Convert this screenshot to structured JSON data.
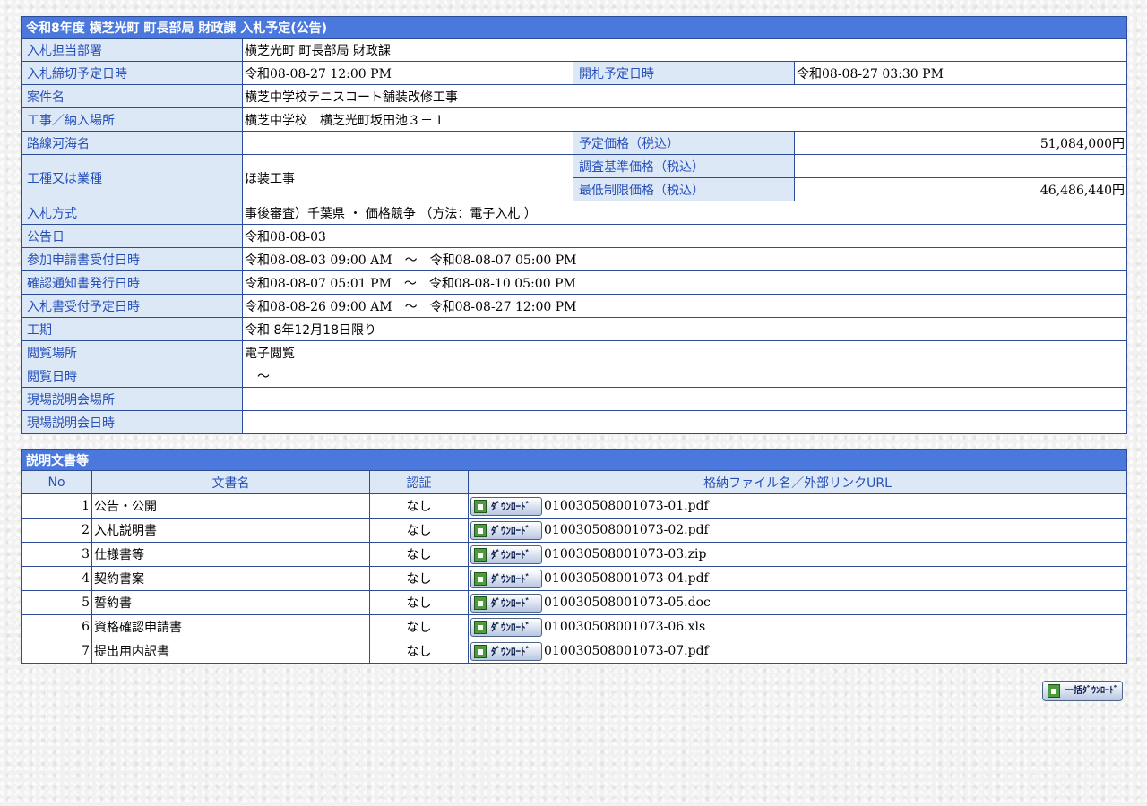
{
  "info": {
    "title": "令和8年度  横芝光町  町長部局  財政課  入札予定(公告)",
    "dept": {
      "label": "入札担当部署",
      "value": "横芝光町  町長部局  財政課"
    },
    "deadline": {
      "label": "入札締切予定日時",
      "value": "令和08-08-27 12:00 PM"
    },
    "opening": {
      "label": "開札予定日時",
      "value": "令和08-08-27 03:30 PM"
    },
    "project": {
      "label": "案件名",
      "value": "横芝中学校テニスコート舗装改修工事"
    },
    "location": {
      "label": "工事／納入場所",
      "value": "横芝中学校　横芝光町坂田池３－１"
    },
    "route": {
      "label": "路線河海名",
      "value": ""
    },
    "est_price": {
      "label": "予定価格（税込）",
      "value": "51,084,000円"
    },
    "work_type": {
      "label": "工種又は業種",
      "value": "ほ装工事"
    },
    "survey_price": {
      "label": "調査基準価格（税込）",
      "value": "-"
    },
    "min_price": {
      "label": "最低制限価格（税込）",
      "value": "46,486,440円"
    },
    "method": {
      "label": "入札方式",
      "value": "事後審査）千葉県 ・ 価格競争 （方法：電子入札 ）"
    },
    "notice_date": {
      "label": "公告日",
      "value": "令和08-08-03"
    },
    "apply": {
      "label": "参加申請書受付日時",
      "value": "令和08-08-03 09:00 AM　～　令和08-08-07 05:00 PM"
    },
    "confirm": {
      "label": "確認通知書発行日時",
      "value": "令和08-08-07 05:01 PM　～　令和08-08-10 05:00 PM"
    },
    "bid_accept": {
      "label": "入札書受付予定日時",
      "value": "令和08-08-26 09:00 AM　～　令和08-08-27 12:00 PM"
    },
    "period": {
      "label": "工期",
      "value": "令和 8年12月18日限り"
    },
    "view_place": {
      "label": "閲覧場所",
      "value": "電子閲覧"
    },
    "view_time": {
      "label": "閲覧日時",
      "value": "　～"
    },
    "briefing_place": {
      "label": "現場説明会場所",
      "value": ""
    },
    "briefing_time": {
      "label": "現場説明会日時",
      "value": ""
    }
  },
  "docs": {
    "title": "説明文書等",
    "headers": {
      "no": "No",
      "name": "文書名",
      "auth": "認証",
      "file": "格納ファイル名／外部リンクURL"
    },
    "download_label": "ﾀﾞｳﾝﾛｰﾄﾞ",
    "rows": [
      {
        "no": "1",
        "name": "公告・公開",
        "auth": "なし",
        "file": "010030508001073-01.pdf"
      },
      {
        "no": "2",
        "name": "入札説明書",
        "auth": "なし",
        "file": "010030508001073-02.pdf"
      },
      {
        "no": "3",
        "name": "仕様書等",
        "auth": "なし",
        "file": "010030508001073-03.zip"
      },
      {
        "no": "4",
        "name": "契約書案",
        "auth": "なし",
        "file": "010030508001073-04.pdf"
      },
      {
        "no": "5",
        "name": "誓約書",
        "auth": "なし",
        "file": "010030508001073-05.doc"
      },
      {
        "no": "6",
        "name": "資格確認申請書",
        "auth": "なし",
        "file": "010030508001073-06.xls"
      },
      {
        "no": "7",
        "name": "提出用内訳書",
        "auth": "なし",
        "file": "010030508001073-07.pdf"
      }
    ]
  },
  "bulk_download_label": "一括ﾀﾞｳﾝﾛｰﾄﾞ"
}
